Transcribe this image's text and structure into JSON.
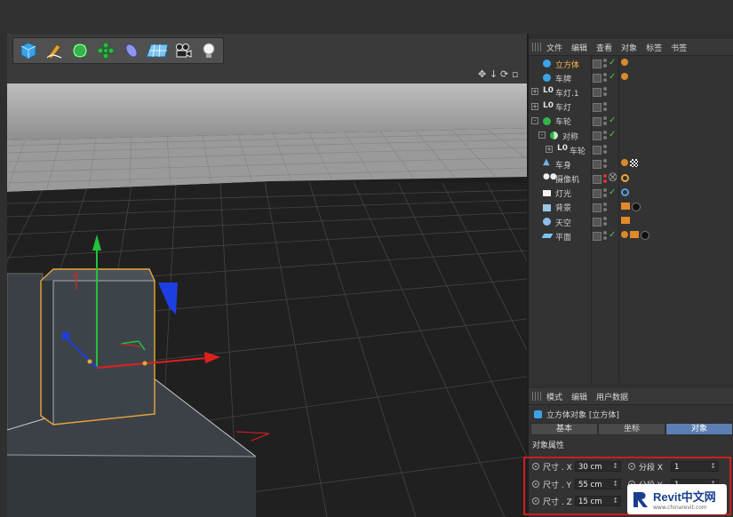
{
  "object_manager": {
    "menu": [
      "文件",
      "编辑",
      "查看",
      "对象",
      "标签",
      "书签"
    ],
    "objects": [
      {
        "name": "立方体",
        "icon": "cube-icon",
        "indent": 0,
        "selected": true,
        "expander": ""
      },
      {
        "name": "车牌",
        "icon": "cube-icon",
        "indent": 0,
        "selected": false,
        "expander": ""
      },
      {
        "name": "车灯.1",
        "icon": "null-icon",
        "indent": 0,
        "selected": false,
        "expander": "+"
      },
      {
        "name": "车灯",
        "icon": "null-icon",
        "indent": 0,
        "selected": false,
        "expander": "+"
      },
      {
        "name": "车轮",
        "icon": "sphere-icon",
        "indent": 0,
        "selected": false,
        "expander": "-"
      },
      {
        "name": "对称",
        "icon": "symmetry-icon",
        "indent": 1,
        "selected": false,
        "expander": "-"
      },
      {
        "name": "车轮",
        "icon": "null-icon",
        "indent": 2,
        "selected": false,
        "expander": "+"
      },
      {
        "name": "车身",
        "icon": "body-icon",
        "indent": 0,
        "selected": false,
        "expander": ""
      },
      {
        "name": "摄像机",
        "icon": "camera-icon",
        "indent": 0,
        "selected": false,
        "expander": ""
      },
      {
        "name": "灯光",
        "icon": "light-icon",
        "indent": 0,
        "selected": false,
        "expander": ""
      },
      {
        "name": "背景",
        "icon": "background-icon",
        "indent": 0,
        "selected": false,
        "expander": ""
      },
      {
        "name": "天空",
        "icon": "sky-icon",
        "indent": 0,
        "selected": false,
        "expander": ""
      },
      {
        "name": "平面",
        "icon": "plane-icon",
        "indent": 0,
        "selected": false,
        "expander": ""
      }
    ]
  },
  "attributes": {
    "menu": [
      "模式",
      "编辑",
      "用户数据"
    ],
    "title": "立方体对象 [立方体]",
    "tabs": [
      "基本",
      "坐标",
      "对象"
    ],
    "active_tab": "对象",
    "section": "对象属性",
    "fields": [
      {
        "label": "尺寸 . X",
        "value": "30 cm",
        "seg_label": "分段 X",
        "seg_value": "1"
      },
      {
        "label": "尺寸 . Y",
        "value": "55 cm",
        "seg_label": "分段 Y",
        "seg_value": "1"
      },
      {
        "label": "尺寸 . Z",
        "value": "15 cm",
        "seg_label": "",
        "seg_value": ""
      }
    ]
  },
  "toolbar": {
    "tools": [
      "cube-icon",
      "pen-icon",
      "subdivision-icon",
      "array-icon",
      "deformer-icon",
      "floor-icon",
      "camera-icon",
      "light-icon"
    ]
  },
  "viewport": {
    "controls": [
      "move-view-icon",
      "zoom-view-icon",
      "rotate-view-icon",
      "maximize-view-icon"
    ]
  },
  "watermark": {
    "brand": "Revit中文网",
    "url": "www.chinarevit.com"
  },
  "colors": {
    "selection": "#ffb44a",
    "active_tab": "#5b7fb0",
    "highlight_box": "#d11c1c",
    "axis_x": "#e0201e",
    "axis_y": "#22c33b",
    "axis_z": "#1d3ee0"
  }
}
